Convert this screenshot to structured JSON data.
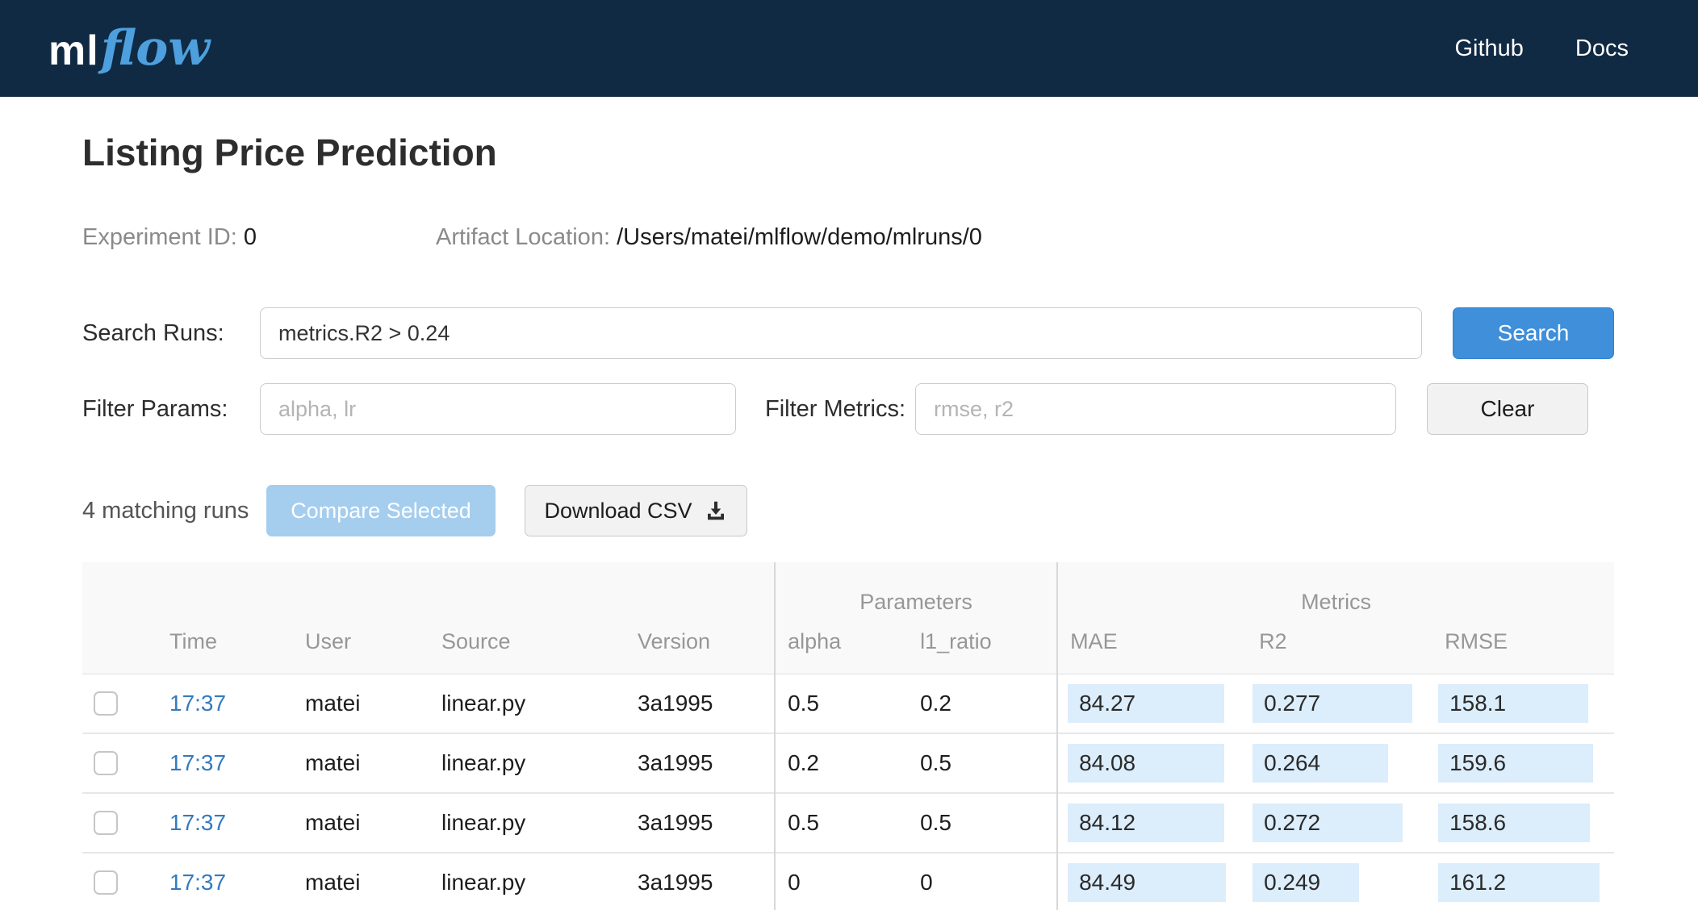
{
  "navbar": {
    "brand_ml": "ml",
    "brand_flow": "flow",
    "links": [
      {
        "label": "Github"
      },
      {
        "label": "Docs"
      }
    ]
  },
  "header": {
    "title": "Listing Price Prediction",
    "experiment_id_label": "Experiment ID:",
    "experiment_id_value": "0",
    "artifact_location_label": "Artifact Location:",
    "artifact_location_value": "/Users/matei/mlflow/demo/mlruns/0"
  },
  "search": {
    "label": "Search Runs:",
    "value": "metrics.R2 > 0.24",
    "button_label": "Search"
  },
  "filters": {
    "params_label": "Filter Params:",
    "params_placeholder": "alpha, lr",
    "metrics_label": "Filter Metrics:",
    "metrics_placeholder": "rmse, r2",
    "clear_button_label": "Clear"
  },
  "actions": {
    "matching_runs_text": "4 matching runs",
    "compare_button_label": "Compare Selected",
    "download_button_label": "Download CSV"
  },
  "table": {
    "group_headers": {
      "parameters": "Parameters",
      "metrics": "Metrics"
    },
    "columns": {
      "time": "Time",
      "user": "User",
      "source": "Source",
      "version": "Version",
      "alpha": "alpha",
      "l1_ratio": "l1_ratio",
      "mae": "MAE",
      "r2": "R2",
      "rmse": "RMSE"
    },
    "rows": [
      {
        "time": "17:37",
        "user": "matei",
        "source": "linear.py",
        "version": "3a1995",
        "alpha": "0.5",
        "l1_ratio": "0.2",
        "mae": "84.27",
        "mae_pct": 97,
        "r2": "0.277",
        "r2_pct": 99,
        "rmse": "158.1",
        "rmse_pct": 93
      },
      {
        "time": "17:37",
        "user": "matei",
        "source": "linear.py",
        "version": "3a1995",
        "alpha": "0.2",
        "l1_ratio": "0.5",
        "mae": "84.08",
        "mae_pct": 97,
        "r2": "0.264",
        "r2_pct": 84,
        "rmse": "159.6",
        "rmse_pct": 96
      },
      {
        "time": "17:37",
        "user": "matei",
        "source": "linear.py",
        "version": "3a1995",
        "alpha": "0.5",
        "l1_ratio": "0.5",
        "mae": "84.12",
        "mae_pct": 97,
        "r2": "0.272",
        "r2_pct": 93,
        "rmse": "158.6",
        "rmse_pct": 94
      },
      {
        "time": "17:37",
        "user": "matei",
        "source": "linear.py",
        "version": "3a1995",
        "alpha": "0",
        "l1_ratio": "0",
        "mae": "84.49",
        "mae_pct": 98,
        "r2": "0.249",
        "r2_pct": 66,
        "rmse": "161.2",
        "rmse_pct": 100
      }
    ]
  },
  "colors": {
    "navbar_bg": "#102a43",
    "brand_blue": "#4da0dd",
    "primary_button": "#3f8fdb",
    "disabled_button": "#a5cdee",
    "link_blue": "#347abe",
    "metric_highlight": "#dcedfb"
  }
}
